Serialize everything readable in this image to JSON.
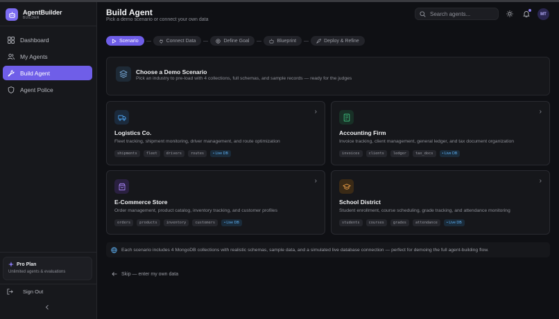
{
  "brand": {
    "name": "AgentBuilder",
    "sub": "BUILDER"
  },
  "nav": {
    "dashboard": "Dashboard",
    "my_agents": "My Agents",
    "build_agent": "Build Agent",
    "agent_police": "Agent Police"
  },
  "plan": {
    "title": "Pro Plan",
    "sub": "Unlimited agents & evaluations"
  },
  "signout": "Sign Out",
  "header": {
    "title": "Build Agent",
    "subtitle": "Pick a demo scenario or connect your own data",
    "search_placeholder": "Search agents...",
    "avatar_initials": "MT"
  },
  "steps": {
    "scenario": "Scenario",
    "connect": "Connect Data",
    "goal": "Define Goal",
    "blueprint": "Blueprint",
    "deploy": "Deploy & Refine"
  },
  "banner": {
    "title": "Choose a Demo Scenario",
    "sub": "Pick an industry to pre-load with 4 collections, full schemas, and sample records — ready for the judges"
  },
  "cards": {
    "logistics": {
      "title": "Logistics Co.",
      "desc": "Fleet tracking, shipment monitoring, driver management, and route optimization",
      "tags": [
        "shipments",
        "fleet",
        "drivers",
        "routes"
      ]
    },
    "accounting": {
      "title": "Accounting Firm",
      "desc": "Invoice tracking, client management, general ledger, and tax document organization",
      "tags": [
        "invoices",
        "clients",
        "ledger",
        "tax_docs"
      ]
    },
    "ecommerce": {
      "title": "E-Commerce Store",
      "desc": "Order management, product catalog, inventory tracking, and customer profiles",
      "tags": [
        "orders",
        "products",
        "inventory",
        "customers"
      ]
    },
    "school": {
      "title": "School District",
      "desc": "Student enrollment, course scheduling, grade tracking, and attendance monitoring",
      "tags": [
        "students",
        "courses",
        "grades",
        "attendance"
      ]
    },
    "live_label": "• Live DB"
  },
  "note": "Each scenario includes 4 MongoDB collections with realistic schemas, sample data, and a simulated live database connection — perfect for demoing the full agent-building flow.",
  "skip": "Skip — enter my own data",
  "colors": {
    "accent": "#6f5ee8",
    "logistics": "#4a9eea",
    "accounting": "#3fbf7f",
    "ecommerce": "#a684f5",
    "school": "#f0a24a",
    "live": "#5fb2f5"
  }
}
